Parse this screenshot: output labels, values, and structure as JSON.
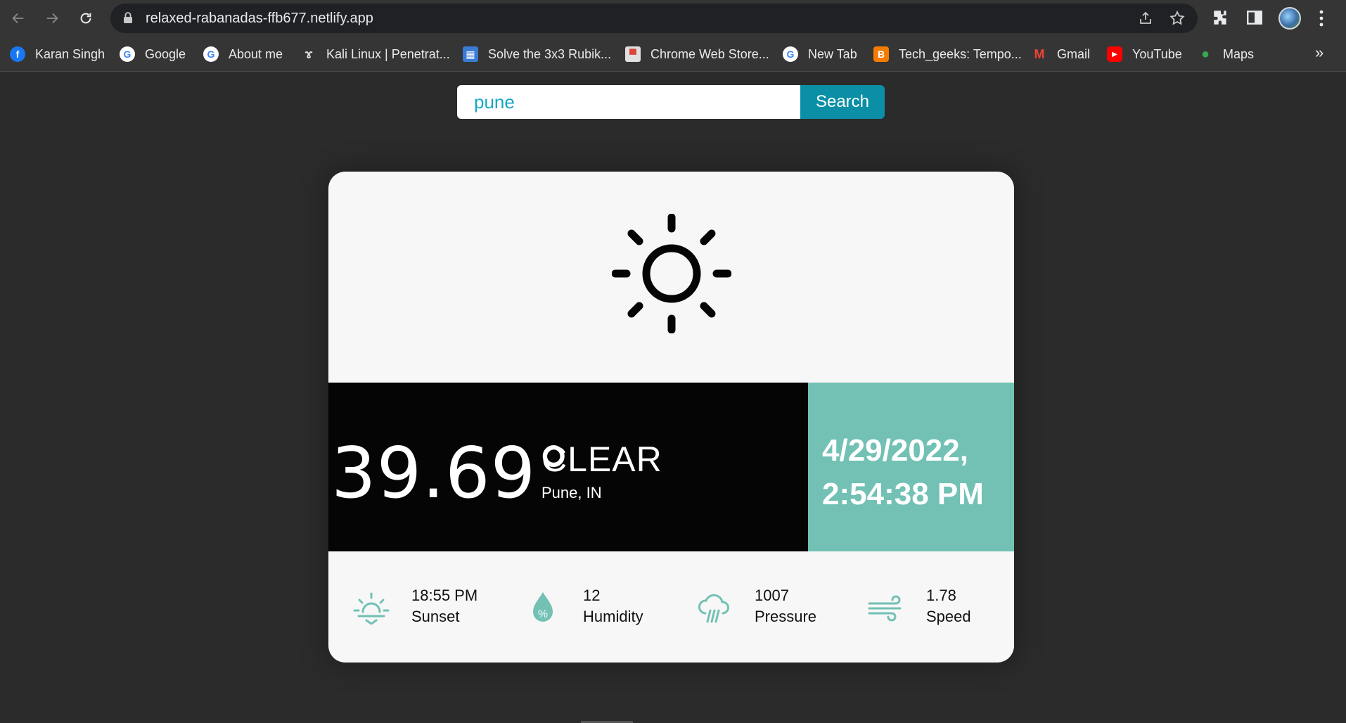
{
  "browser": {
    "url": "relaxed-rabanadas-ffb677.netlify.app",
    "icons": [
      "back-icon",
      "forward-icon",
      "reload-icon",
      "lock-icon",
      "share-icon",
      "star-icon",
      "extensions-icon",
      "side-panel-icon",
      "profile-avatar",
      "more-icon"
    ],
    "bookmarks": [
      {
        "label": "Karan Singh",
        "icon": "facebook-icon",
        "color": "#1877f2"
      },
      {
        "label": "Google",
        "icon": "google-icon",
        "color": "#ffffff"
      },
      {
        "label": "About me",
        "icon": "google-icon",
        "color": "#ffffff"
      },
      {
        "label": "Kali Linux | Penetrat...",
        "icon": "kali-dragon-icon",
        "color": "#cccccc"
      },
      {
        "label": "Solve the 3x3 Rubik...",
        "icon": "rubik-icon",
        "color": "#3a7bd5"
      },
      {
        "label": "Chrome Web Store...",
        "icon": "web-store-icon",
        "color": "#e0e0e0"
      },
      {
        "label": "New Tab",
        "icon": "google-icon",
        "color": "#ffffff"
      },
      {
        "label": "Tech_geeks: Tempo...",
        "icon": "blogger-icon",
        "color": "#f57c00"
      },
      {
        "label": "Gmail",
        "icon": "gmail-icon",
        "color": "#ea4335"
      },
      {
        "label": "YouTube",
        "icon": "youtube-icon",
        "color": "#ff0000"
      },
      {
        "label": "Maps",
        "icon": "maps-icon",
        "color": "#34a853"
      }
    ],
    "more_bookmarks": "»"
  },
  "search": {
    "value": "pune",
    "button_label": "Search"
  },
  "weather": {
    "icon": "sun-icon",
    "temperature": "39.69°",
    "condition": "CLEAR",
    "location": "Pune, IN",
    "date": "4/29/2022,",
    "time": "2:54:38 PM",
    "accent_color": "#72c1b4",
    "stats": [
      {
        "icon": "sunset-icon",
        "value": "18:55 PM",
        "label": "Sunset"
      },
      {
        "icon": "humidity-icon",
        "value": "12",
        "label": "Humidity"
      },
      {
        "icon": "pressure-icon",
        "value": "1007",
        "label": "Pressure"
      },
      {
        "icon": "wind-icon",
        "value": "1.78",
        "label": "Speed"
      }
    ]
  }
}
